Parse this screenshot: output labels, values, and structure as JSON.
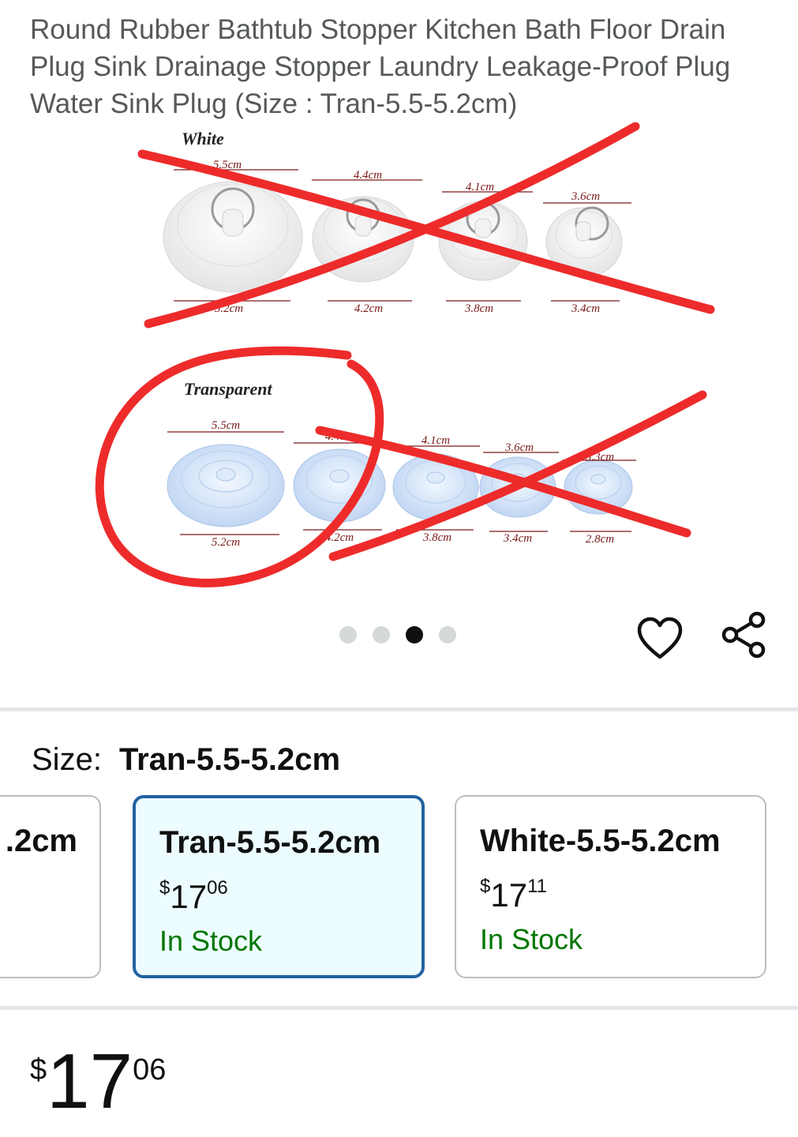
{
  "product": {
    "title": "Round Rubber Bathtub Stopper Kitchen Bath Floor Drain Plug Sink Drainage Stopper Laundry Leakage-Proof Plug Water Sink Plug (Size : Tran-5.5-5.2cm)"
  },
  "image": {
    "white_label": "White",
    "transparent_label": "Transparent",
    "white_top_dims": [
      "5.5cm",
      "4.4cm",
      "4.1cm",
      "3.6cm"
    ],
    "white_bottom_dims": [
      "5.2cm",
      "4.2cm",
      "3.8cm",
      "3.4cm"
    ],
    "tran_top_dims": [
      "5.5cm",
      "4.4cm",
      "4.1cm",
      "3.6cm",
      "3.3cm"
    ],
    "tran_bottom_dims": [
      "5.2cm",
      "4.2cm",
      "3.8cm",
      "3.4cm",
      "2.8cm"
    ],
    "markup_color": "#ee2b2b"
  },
  "carousel": {
    "count": 4,
    "active_index": 2
  },
  "icons": {
    "wishlist": "heart-icon",
    "share": "share-icon"
  },
  "size": {
    "label": "Size:",
    "selected": "Tran-5.5-5.2cm"
  },
  "options": [
    {
      "name": ".2cm"
    },
    {
      "name": "Tran-5.5-5.2cm",
      "currency": "$",
      "whole": "17",
      "cents": "06",
      "stock": "In Stock"
    },
    {
      "name": "White-5.5-5.2cm",
      "currency": "$",
      "whole": "17",
      "cents": "11",
      "stock": "In Stock"
    }
  ],
  "price": {
    "currency": "$",
    "whole": "17",
    "cents": "06"
  },
  "colors": {
    "accent": "#2162a1",
    "in_stock": "#007600",
    "selected_bg": "#edfdff"
  }
}
